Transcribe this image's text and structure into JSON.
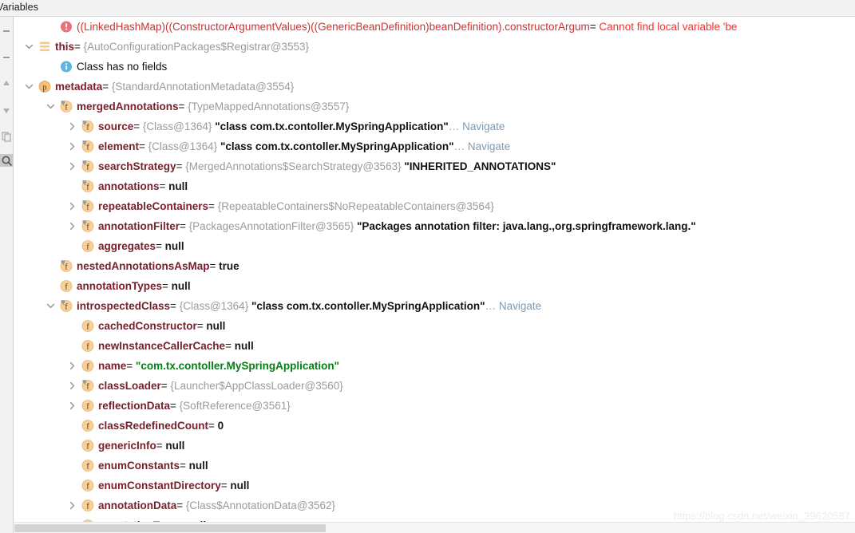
{
  "panel": {
    "tab_label": "Variables",
    "watermark": "https://blog.csdn.net/weixin_39620587"
  },
  "left_toolbar": {
    "items": [
      {
        "name": "minus-icon",
        "label": "−"
      },
      {
        "name": "minus-icon-2",
        "label": "−"
      },
      {
        "name": "arrow-up-icon",
        "label": "▲"
      },
      {
        "name": "arrow-down-icon",
        "label": "▼"
      },
      {
        "name": "copy-icon",
        "label": "❐"
      },
      {
        "name": "search-icon",
        "label": "○"
      }
    ]
  },
  "tree": {
    "rows": [
      {
        "id": "row-error-expression",
        "indent": 1,
        "twisty": "none",
        "icon": "error-icon",
        "name": "((LinkedHashMap)((ConstructorArgumentValues)((GenericBeanDefinition)beanDefinition).constructorArgum",
        "name_style": "verrname",
        "eq": "=",
        "segments": [
          {
            "text": "Cannot find local variable 'be",
            "style": "verror"
          }
        ]
      },
      {
        "id": "row-this",
        "indent": 0,
        "twisty": "expanded",
        "icon": "object-list-icon",
        "name": "this",
        "eq": "=",
        "segments": [
          {
            "text": "{AutoConfigurationPackages$Registrar@3553}",
            "style": "vtype"
          }
        ]
      },
      {
        "id": "row-class-has-no-fields",
        "indent": 1,
        "twisty": "none",
        "icon": "info-icon",
        "name": "",
        "eq": "",
        "segments": [
          {
            "text": "Class has no fields",
            "style": "vinfo"
          }
        ]
      },
      {
        "id": "row-metadata",
        "indent": 0,
        "twisty": "expanded",
        "icon": "param-icon",
        "name": "metadata",
        "eq": "=",
        "segments": [
          {
            "text": "{StandardAnnotationMetadata@3554}",
            "style": "vtype"
          }
        ]
      },
      {
        "id": "row-mergedAnnotations",
        "indent": 1,
        "twisty": "expanded",
        "icon": "final-field-icon",
        "name": "mergedAnnotations",
        "eq": "=",
        "segments": [
          {
            "text": "{TypeMappedAnnotations@3557}",
            "style": "vtype"
          }
        ]
      },
      {
        "id": "row-source",
        "indent": 2,
        "twisty": "collapsed",
        "icon": "final-field-icon",
        "name": "source",
        "eq": "=",
        "segments": [
          {
            "text": "{Class@1364} ",
            "style": "vtype"
          },
          {
            "text": "\"class com.tx.contoller.MySpringApplication\"",
            "style": "vstr"
          },
          {
            "text": "… ",
            "style": "vellip"
          },
          {
            "text": "Navigate",
            "style": "vnav"
          }
        ]
      },
      {
        "id": "row-element",
        "indent": 2,
        "twisty": "collapsed",
        "icon": "final-field-icon",
        "name": "element",
        "eq": "=",
        "segments": [
          {
            "text": "{Class@1364} ",
            "style": "vtype"
          },
          {
            "text": "\"class com.tx.contoller.MySpringApplication\"",
            "style": "vstr"
          },
          {
            "text": "… ",
            "style": "vellip"
          },
          {
            "text": "Navigate",
            "style": "vnav"
          }
        ]
      },
      {
        "id": "row-searchStrategy",
        "indent": 2,
        "twisty": "collapsed",
        "icon": "final-field-icon",
        "name": "searchStrategy",
        "eq": "=",
        "segments": [
          {
            "text": "{MergedAnnotations$SearchStrategy@3563} ",
            "style": "vtype"
          },
          {
            "text": "\"INHERITED_ANNOTATIONS\"",
            "style": "vstr"
          }
        ]
      },
      {
        "id": "row-annotations",
        "indent": 2,
        "twisty": "none",
        "icon": "final-field-icon",
        "name": "annotations",
        "eq": "=",
        "segments": [
          {
            "text": "null",
            "style": "vnull"
          }
        ]
      },
      {
        "id": "row-repeatableContainers",
        "indent": 2,
        "twisty": "collapsed",
        "icon": "final-field-icon",
        "name": "repeatableContainers",
        "eq": "=",
        "segments": [
          {
            "text": "{RepeatableContainers$NoRepeatableContainers@3564}",
            "style": "vtype"
          }
        ]
      },
      {
        "id": "row-annotationFilter",
        "indent": 2,
        "twisty": "collapsed",
        "icon": "final-field-icon",
        "name": "annotationFilter",
        "eq": "=",
        "segments": [
          {
            "text": "{PackagesAnnotationFilter@3565} ",
            "style": "vtype"
          },
          {
            "text": "\"Packages annotation filter: java.lang.,org.springframework.lang.\"",
            "style": "vstr"
          }
        ]
      },
      {
        "id": "row-aggregates",
        "indent": 2,
        "twisty": "none",
        "icon": "field-icon",
        "name": "aggregates",
        "eq": "=",
        "segments": [
          {
            "text": "null",
            "style": "vnull"
          }
        ]
      },
      {
        "id": "row-nestedAnnotationsAsMap",
        "indent": 1,
        "twisty": "none",
        "icon": "final-field-icon",
        "name": "nestedAnnotationsAsMap",
        "eq": "=",
        "segments": [
          {
            "text": "true",
            "style": "vnull"
          }
        ]
      },
      {
        "id": "row-annotationTypes",
        "indent": 1,
        "twisty": "none",
        "icon": "field-icon",
        "name": "annotationTypes",
        "eq": "=",
        "segments": [
          {
            "text": "null",
            "style": "vnull"
          }
        ]
      },
      {
        "id": "row-introspectedClass",
        "indent": 1,
        "twisty": "expanded",
        "icon": "final-field-icon",
        "name": "introspectedClass",
        "eq": "=",
        "segments": [
          {
            "text": "{Class@1364} ",
            "style": "vtype"
          },
          {
            "text": "\"class com.tx.contoller.MySpringApplication\"",
            "style": "vstr"
          },
          {
            "text": "… ",
            "style": "vellip"
          },
          {
            "text": "Navigate",
            "style": "vnav"
          }
        ]
      },
      {
        "id": "row-cachedConstructor",
        "indent": 2,
        "twisty": "none",
        "icon": "field-icon",
        "name": "cachedConstructor",
        "eq": "=",
        "segments": [
          {
            "text": "null",
            "style": "vnull"
          }
        ]
      },
      {
        "id": "row-newInstanceCallerCache",
        "indent": 2,
        "twisty": "none",
        "icon": "field-icon",
        "name": "newInstanceCallerCache",
        "eq": "=",
        "segments": [
          {
            "text": "null",
            "style": "vnull"
          }
        ]
      },
      {
        "id": "row-name",
        "indent": 2,
        "twisty": "collapsed",
        "icon": "field-icon",
        "name": "name",
        "eq": "=",
        "segments": [
          {
            "text": "\"com.tx.contoller.MySpringApplication\"",
            "style": "vgreen"
          }
        ]
      },
      {
        "id": "row-classLoader",
        "indent": 2,
        "twisty": "collapsed",
        "icon": "final-field-icon",
        "name": "classLoader",
        "eq": "=",
        "segments": [
          {
            "text": "{Launcher$AppClassLoader@3560}",
            "style": "vtype"
          }
        ]
      },
      {
        "id": "row-reflectionData",
        "indent": 2,
        "twisty": "collapsed",
        "icon": "field-icon",
        "name": "reflectionData",
        "eq": "=",
        "segments": [
          {
            "text": "{SoftReference@3561}",
            "style": "vtype"
          }
        ]
      },
      {
        "id": "row-classRedefinedCount",
        "indent": 2,
        "twisty": "none",
        "icon": "field-icon",
        "name": "classRedefinedCount",
        "eq": "=",
        "segments": [
          {
            "text": "0",
            "style": "vnull"
          }
        ]
      },
      {
        "id": "row-genericInfo",
        "indent": 2,
        "twisty": "none",
        "icon": "field-icon",
        "name": "genericInfo",
        "eq": "=",
        "segments": [
          {
            "text": "null",
            "style": "vnull"
          }
        ]
      },
      {
        "id": "row-enumConstants",
        "indent": 2,
        "twisty": "none",
        "icon": "field-icon",
        "name": "enumConstants",
        "eq": "=",
        "segments": [
          {
            "text": "null",
            "style": "vnull"
          }
        ]
      },
      {
        "id": "row-enumConstantDirectory",
        "indent": 2,
        "twisty": "none",
        "icon": "field-icon",
        "name": "enumConstantDirectory",
        "eq": "=",
        "segments": [
          {
            "text": "null",
            "style": "vnull"
          }
        ]
      },
      {
        "id": "row-annotationData",
        "indent": 2,
        "twisty": "collapsed",
        "icon": "field-icon",
        "name": "annotationData",
        "eq": "=",
        "segments": [
          {
            "text": "{Class$AnnotationData@3562}",
            "style": "vtype"
          }
        ]
      },
      {
        "id": "row-annotationType",
        "indent": 2,
        "twisty": "none",
        "icon": "field-icon",
        "name": "annotationType",
        "eq": "=",
        "segments": [
          {
            "text": "null",
            "style": "vnull"
          }
        ]
      }
    ]
  },
  "colors": {
    "field_icon_fill": "#f5c98c",
    "param_icon_fill": "#f0bf7a",
    "error_icon_fill": "#e57373",
    "info_icon_fill": "#56b6e0",
    "name_color": "#76202b",
    "type_color": "#9b9b9b",
    "string_color": "#111111",
    "green_string_color": "#067d17",
    "navigate_color": "#7f99b3",
    "error_color": "#ff2b2b"
  }
}
